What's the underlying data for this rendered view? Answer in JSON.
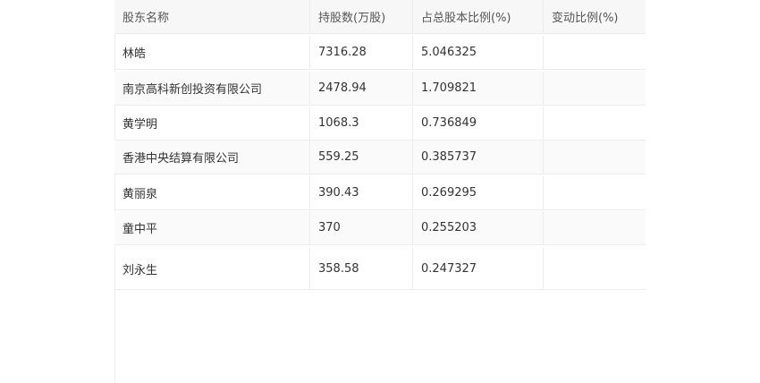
{
  "table": {
    "headers": [
      "股东名称",
      "持股数(万股)",
      "占总股本比例(%)",
      "变动比例(%)"
    ],
    "rows": [
      [
        "林皓",
        "7316.28",
        "5.046325",
        ""
      ],
      [
        "南京高科新创投资有限公司",
        "2478.94",
        "1.709821",
        ""
      ],
      [
        "黄学明",
        "1068.3",
        "0.736849",
        ""
      ],
      [
        "香港中央结算有限公司",
        "559.25",
        "0.385737",
        ""
      ],
      [
        "黄丽泉",
        "390.43",
        "0.269295",
        ""
      ],
      [
        "童中平",
        "370",
        "0.255203",
        ""
      ],
      [
        "刘永生",
        "358.58",
        "0.247327",
        ""
      ]
    ]
  }
}
